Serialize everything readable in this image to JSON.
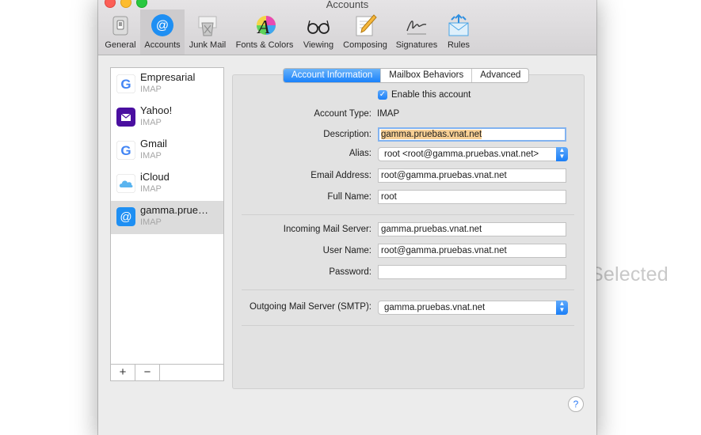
{
  "background": {
    "no_selection_text": "Selected"
  },
  "window": {
    "title": "Accounts"
  },
  "toolbar": {
    "items": [
      {
        "label": "General",
        "icon": "general-switch-icon",
        "active": false
      },
      {
        "label": "Accounts",
        "icon": "at-sign-icon",
        "active": true
      },
      {
        "label": "Junk Mail",
        "icon": "junk-trash-icon",
        "active": false
      },
      {
        "label": "Fonts & Colors",
        "icon": "fonts-colors-icon",
        "active": false
      },
      {
        "label": "Viewing",
        "icon": "glasses-icon",
        "active": false
      },
      {
        "label": "Composing",
        "icon": "pencil-paper-icon",
        "active": false
      },
      {
        "label": "Signatures",
        "icon": "signature-icon",
        "active": false
      },
      {
        "label": "Rules",
        "icon": "rules-envelope-icon",
        "active": false
      }
    ]
  },
  "accounts": [
    {
      "name": "Empresarial",
      "type": "IMAP",
      "icon": "google-icon"
    },
    {
      "name": "Yahoo!",
      "type": "IMAP",
      "icon": "yahoo-mail-icon"
    },
    {
      "name": "Gmail",
      "type": "IMAP",
      "icon": "google-icon"
    },
    {
      "name": "iCloud",
      "type": "IMAP",
      "icon": "icloud-icon"
    },
    {
      "name": "gamma.prue…",
      "type": "IMAP",
      "icon": "at-account-icon",
      "selected": true
    }
  ],
  "sidebar_buttons": {
    "add": "+",
    "remove": "−"
  },
  "tabs": [
    "Account Information",
    "Mailbox Behaviors",
    "Advanced"
  ],
  "form": {
    "enable_label": "Enable this account",
    "enable_checked": true,
    "account_type_label": "Account Type:",
    "account_type_value": "IMAP",
    "description_label": "Description:",
    "description_value": "gamma.pruebas.vnat.net",
    "alias_label": "Alias:",
    "alias_value": "root <root@gamma.pruebas.vnat.net>",
    "email_label": "Email Address:",
    "email_value": "root@gamma.pruebas.vnat.net",
    "fullname_label": "Full Name:",
    "fullname_value": "root",
    "incoming_label": "Incoming Mail Server:",
    "incoming_value": "gamma.pruebas.vnat.net",
    "username_label": "User Name:",
    "username_value": "root@gamma.pruebas.vnat.net",
    "password_label": "Password:",
    "password_value": "",
    "outgoing_label": "Outgoing Mail Server (SMTP):",
    "outgoing_value": "gamma.pruebas.vnat.net"
  },
  "help_label": "?",
  "colors": {
    "accent": "#1a82fb",
    "selection_highlight": "#f7cf94"
  }
}
